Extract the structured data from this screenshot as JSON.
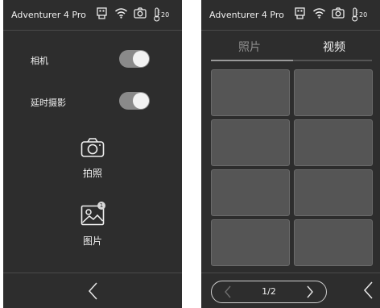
{
  "left_screen": {
    "status": {
      "title": "Adventurer 4 Pro",
      "temperature": "20"
    },
    "settings": [
      {
        "label": "相机",
        "enabled": true
      },
      {
        "label": "延时摄影",
        "enabled": true
      }
    ],
    "actions": {
      "capture_label": "拍照",
      "gallery_label": "图片",
      "gallery_badge": "1"
    },
    "icons": [
      "usb-drive-icon",
      "wifi-icon",
      "camera-icon",
      "thermometer-icon",
      "back-chevron-icon"
    ]
  },
  "right_screen": {
    "status": {
      "title": "Adventurer 4 Pro",
      "temperature": "20"
    },
    "tabs": [
      {
        "label": "照片",
        "active": false
      },
      {
        "label": "视频",
        "active": true
      }
    ],
    "grid": {
      "rows": 4,
      "columns": 2
    },
    "pagination": {
      "page": "1/2"
    }
  },
  "colors": {
    "screen_bg": "#2d2d2d",
    "text": "#f0f0f0",
    "toggle_track": "#8a8a8a",
    "thumbnail": "#555555"
  }
}
